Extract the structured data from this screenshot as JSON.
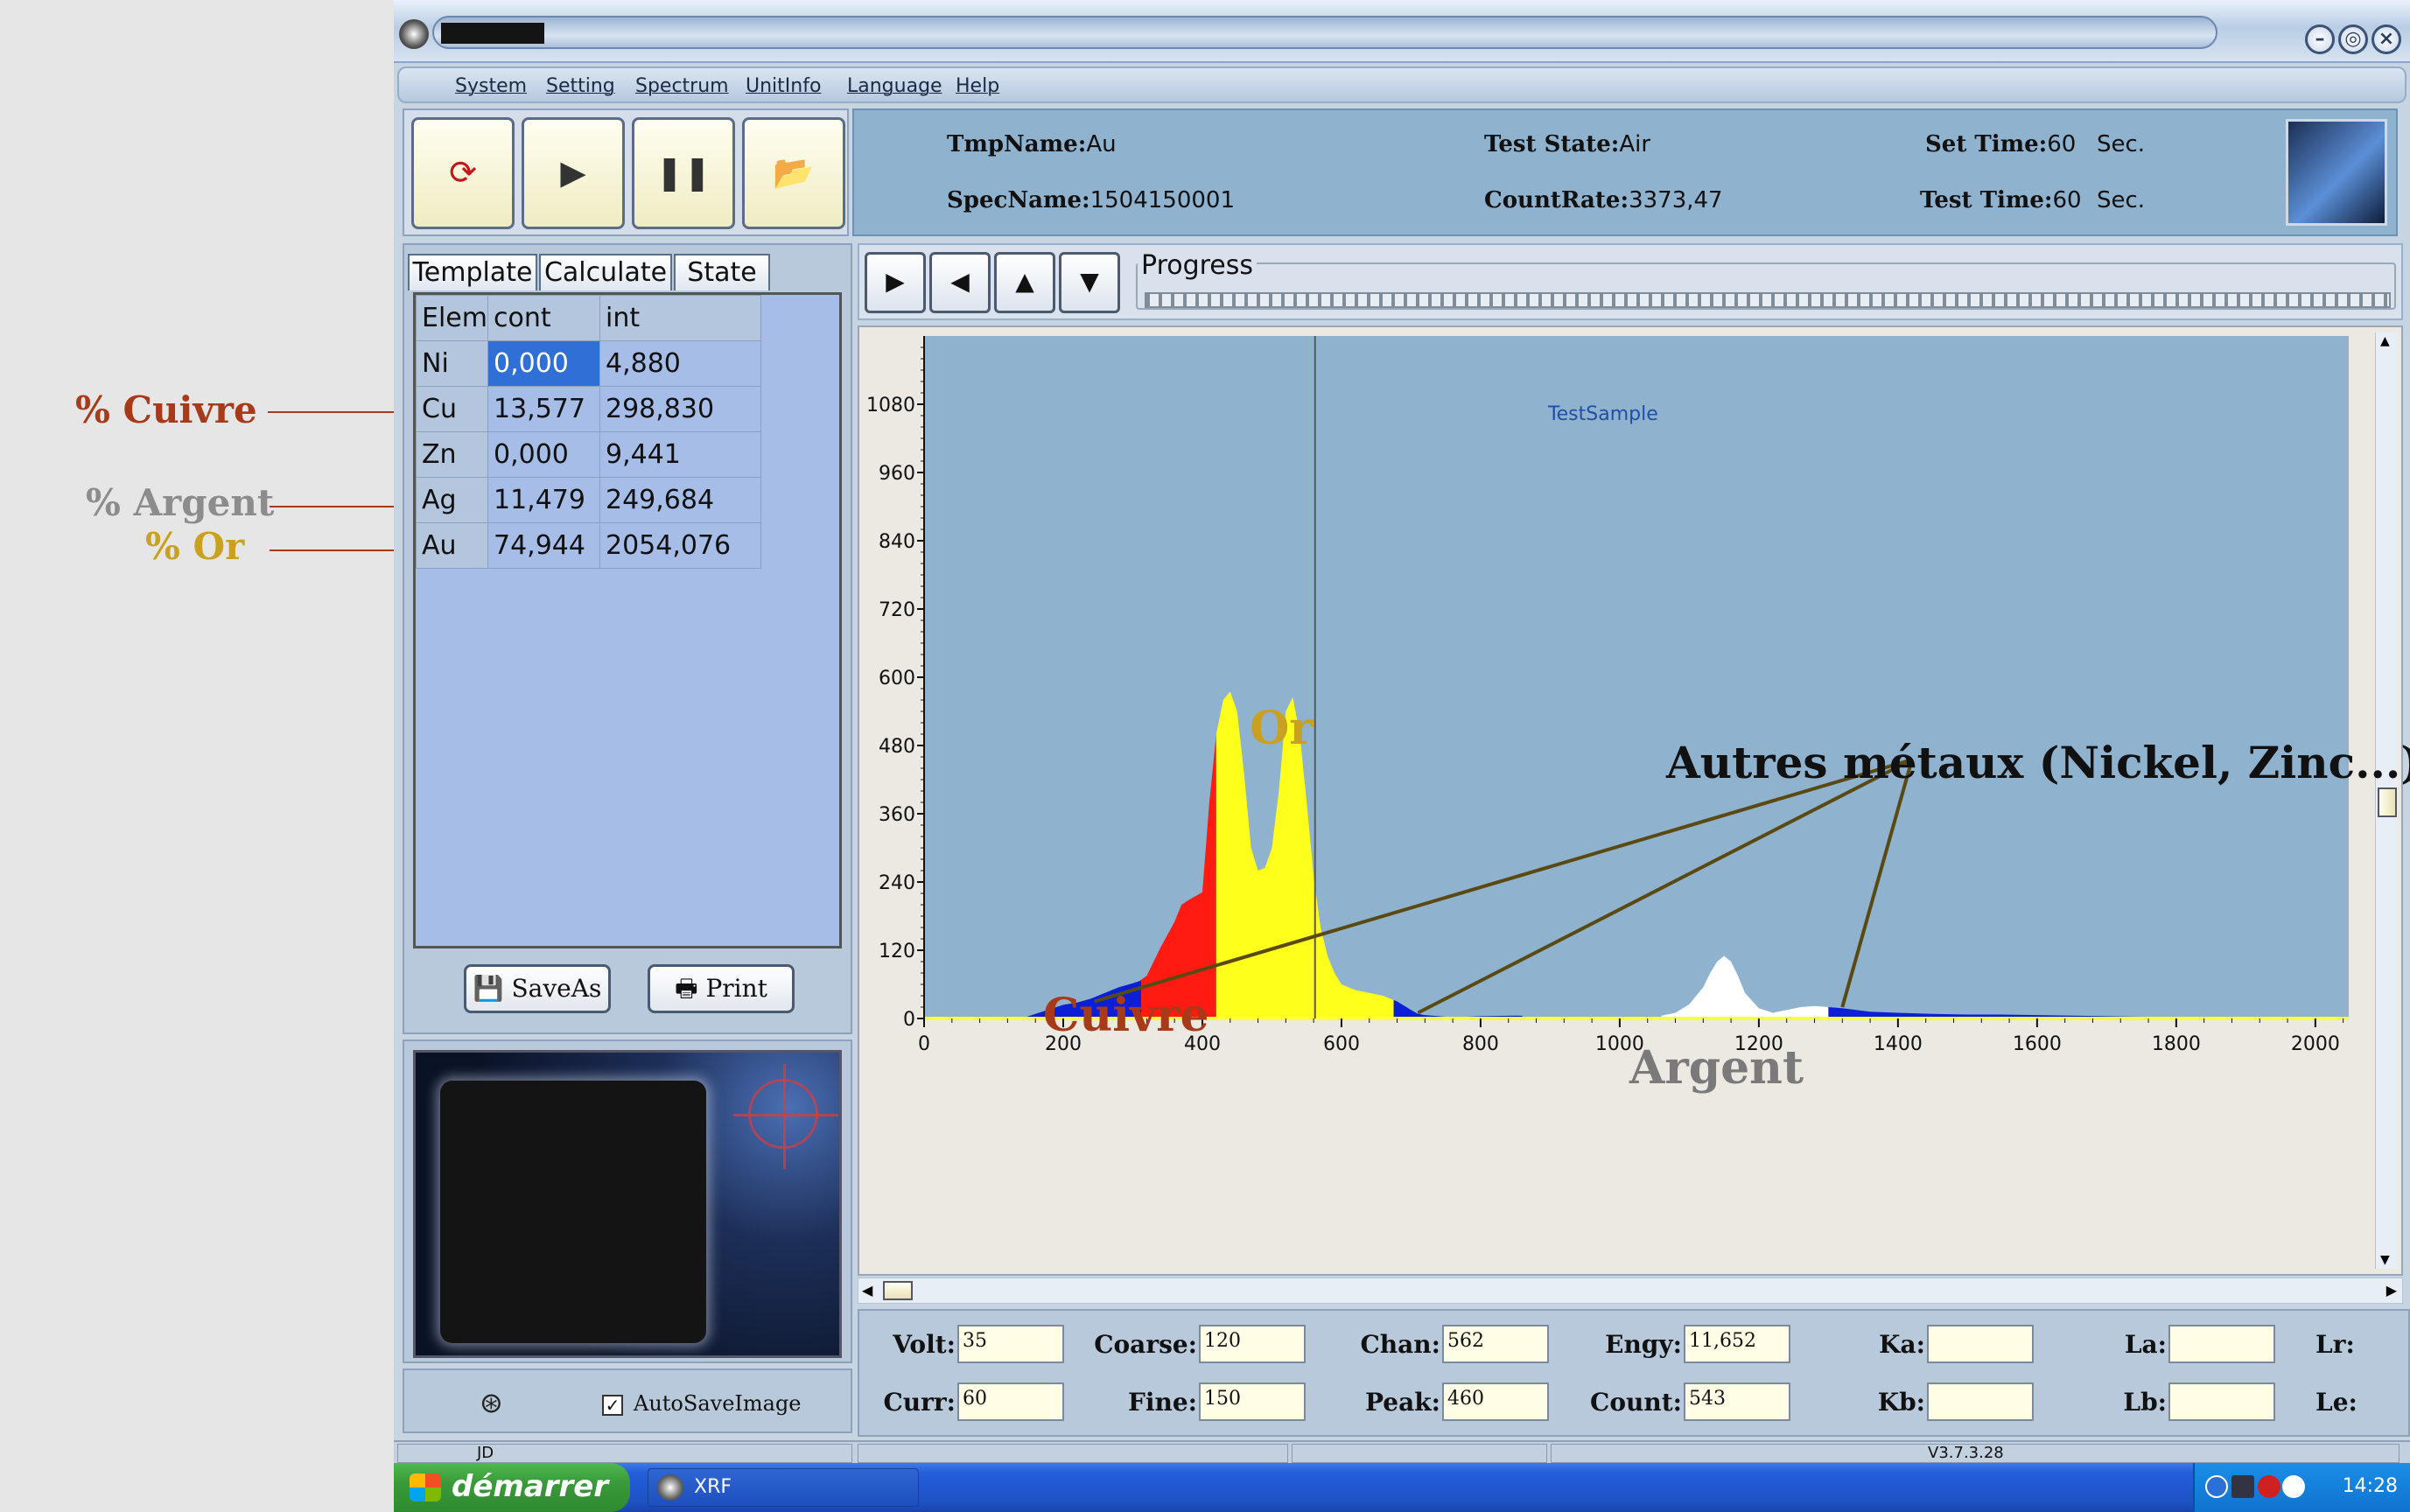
{
  "annotations": {
    "left": [
      {
        "label": "% Cuivre",
        "color": "#a83a1a"
      },
      {
        "label": "% Argent",
        "color": "#8c8c8c"
      },
      {
        "label": "% Or",
        "color": "#c9a020"
      }
    ],
    "peaks": [
      {
        "label": "Cuivre",
        "color": "#a83a1a"
      },
      {
        "label": "Or",
        "color": "#c9a020"
      },
      {
        "label": "Argent",
        "color": "#7a7a7a"
      }
    ],
    "other_metals": "Autres métaux (Nickel, Zinc...)"
  },
  "window": {
    "buttons": {
      "minimize": "–",
      "restore": "◎",
      "close": "×"
    }
  },
  "menu": {
    "items": [
      "System",
      "Setting",
      "Spectrum",
      "UnitInfo",
      "Language",
      "Help"
    ]
  },
  "toolbar": {
    "buttons": [
      {
        "icon": "refresh-icon",
        "glyph": "⟳"
      },
      {
        "icon": "play-icon",
        "glyph": "▶"
      },
      {
        "icon": "pause-icon",
        "glyph": "❚❚"
      },
      {
        "icon": "open-folder-icon",
        "glyph": "📂"
      }
    ]
  },
  "info": {
    "tmp_name_label": "TmpName:",
    "tmp_name_value": "Au",
    "spec_name_label": "SpecName:",
    "spec_name_value": "1504150001",
    "test_state_label": "Test State:",
    "test_state_value": "Air",
    "count_rate_label": "CountRate:",
    "count_rate_value": "3373,47",
    "set_time_label": "Set Time:",
    "set_time_value": "60",
    "test_time_label": "Test Time:",
    "test_time_value": "60",
    "sec_unit": "Sec."
  },
  "tabs": [
    "Template",
    "Calculate",
    "State"
  ],
  "grid": {
    "headers": [
      "Elem",
      "cont",
      "int"
    ],
    "rows": [
      {
        "elem": "Ni",
        "cont": "0,000",
        "int": "4,880"
      },
      {
        "elem": "Cu",
        "cont": "13,577",
        "int": "298,830"
      },
      {
        "elem": "Zn",
        "cont": "0,000",
        "int": "9,441"
      },
      {
        "elem": "Ag",
        "cont": "11,479",
        "int": "249,684"
      },
      {
        "elem": "Au",
        "cont": "74,944",
        "int": "2054,076"
      }
    ]
  },
  "actions": {
    "save_as": "SaveAs",
    "print": "Print",
    "autosave": "AutoSaveImage"
  },
  "progress": {
    "label": "Progress"
  },
  "nav_buttons": [
    "▶",
    "◀",
    "▲",
    "▼"
  ],
  "params": [
    {
      "label": "Volt:",
      "value": "35"
    },
    {
      "label": "Curr:",
      "value": "60"
    },
    {
      "label": "Coarse:",
      "value": "120"
    },
    {
      "label": "Fine:",
      "value": "150"
    },
    {
      "label": "Chan:",
      "value": "562"
    },
    {
      "label": "Peak:",
      "value": "460"
    },
    {
      "label": "Engy:",
      "value": "11,652"
    },
    {
      "label": "Count:",
      "value": "543"
    },
    {
      "label": "Ka:",
      "value": ""
    },
    {
      "label": "Kb:",
      "value": ""
    },
    {
      "label": "La:",
      "value": ""
    },
    {
      "label": "Lb:",
      "value": ""
    },
    {
      "label": "Lr:",
      "value": ""
    },
    {
      "label": "Le:",
      "value": ""
    }
  ],
  "status": {
    "left": "JD",
    "version": "V3.7.3.28"
  },
  "taskbar": {
    "start": "démarrer",
    "task": "XRF",
    "clock": "14:28"
  },
  "chart_data": {
    "type": "area",
    "title": "TestSample",
    "xlabel": "",
    "ylabel": "",
    "xlim": [
      0,
      2048
    ],
    "ylim": [
      0,
      1200
    ],
    "xticks": [
      0,
      200,
      400,
      600,
      800,
      1000,
      1200,
      1400,
      1600,
      1800,
      2000
    ],
    "yticks": [
      0,
      120,
      240,
      360,
      480,
      600,
      720,
      840,
      960,
      1080
    ],
    "cursor_x": 562,
    "grid": false,
    "spectrum": {
      "x": [
        140,
        160,
        180,
        200,
        220,
        240,
        260,
        280,
        300,
        310,
        320,
        340,
        360,
        370,
        380,
        400,
        410,
        420,
        430,
        440,
        450,
        460,
        470,
        480,
        490,
        500,
        510,
        520,
        530,
        540,
        550,
        560,
        570,
        580,
        590,
        600,
        610,
        620,
        640,
        660,
        680,
        700,
        710,
        720,
        740,
        760,
        780,
        800,
        850,
        900,
        950,
        1000,
        1040,
        1060,
        1080,
        1100,
        1120,
        1130,
        1140,
        1150,
        1160,
        1170,
        1180,
        1200,
        1220,
        1240,
        1260,
        1280,
        1300,
        1320,
        1340,
        1360,
        1400,
        1450,
        1500,
        1550,
        1600,
        1650,
        1700,
        1750,
        1800,
        1850,
        1900,
        1950,
        2000,
        2048
      ],
      "y": [
        0,
        8,
        16,
        24,
        28,
        35,
        45,
        55,
        62,
        66,
        75,
        125,
        170,
        200,
        208,
        222,
        380,
        500,
        560,
        575,
        540,
        430,
        300,
        260,
        265,
        300,
        400,
        540,
        565,
        500,
        380,
        250,
        160,
        110,
        80,
        60,
        55,
        50,
        45,
        40,
        30,
        15,
        8,
        6,
        4,
        2,
        3,
        4,
        5,
        4,
        3,
        3,
        3,
        5,
        10,
        25,
        55,
        80,
        100,
        110,
        100,
        75,
        45,
        18,
        10,
        15,
        20,
        22,
        20,
        18,
        15,
        12,
        10,
        8,
        7,
        7,
        6,
        5,
        4,
        3,
        3,
        2,
        2,
        2,
        2,
        0
      ]
    },
    "regions": [
      {
        "name": "Cuivre",
        "from": 140,
        "to": 312,
        "color": "#0a1fd6"
      },
      {
        "name": "Cuivre",
        "from": 312,
        "to": 420,
        "color": "#ff1a12"
      },
      {
        "name": "Or",
        "from": 420,
        "to": 675,
        "color": "#ffff1c"
      },
      {
        "name": "",
        "from": 675,
        "to": 860,
        "color": "#0a1fd6"
      },
      {
        "name": "Argent",
        "from": 1060,
        "to": 1300,
        "color": "#ffffff"
      },
      {
        "name": "",
        "from": 1300,
        "to": 2048,
        "color": "#0a1fd6"
      }
    ]
  }
}
